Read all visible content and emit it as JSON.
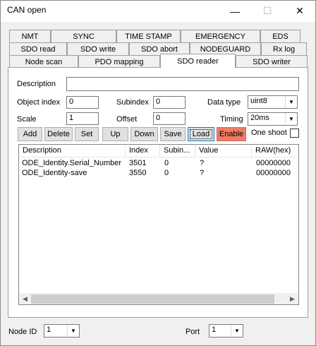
{
  "window": {
    "title": "CAN open",
    "minimize": "—",
    "maximize": "☐",
    "close": "✕"
  },
  "tabs": {
    "row1": [
      "NMT",
      "SYNC",
      "TIME STAMP",
      "EMERGENCY",
      "EDS"
    ],
    "row2": [
      "SDO read",
      "SDO write",
      "SDO abort",
      "NODEGUARD",
      "Rx log"
    ],
    "row3": [
      "Node scan",
      "PDO mapping",
      "SDO reader",
      "SDO writer"
    ],
    "active": "SDO reader"
  },
  "form": {
    "description_label": "Description",
    "description_value": "",
    "object_index_label": "Object index",
    "object_index_value": "0",
    "subindex_label": "Subindex",
    "subindex_value": "0",
    "data_type_label": "Data type",
    "data_type_value": "uint8",
    "scale_label": "Scale",
    "scale_value": "1",
    "offset_label": "Offset",
    "offset_value": "0",
    "timing_label": "Timing",
    "timing_value": "20ms"
  },
  "toolbar": {
    "add": "Add",
    "delete": "Delete",
    "set": "Set",
    "up": "Up",
    "down": "Down",
    "save": "Save",
    "load": "Load",
    "enable": "Enable",
    "one_shot": "One shoot"
  },
  "table": {
    "columns": [
      "Description",
      "Index",
      "Subin...",
      "Value",
      "RAW(hex)"
    ],
    "rows": [
      [
        "ODE_Identity.Serial_Number",
        "3501",
        "0",
        "?",
        "00000000"
      ],
      [
        "ODE_Identity-save",
        "3550",
        "0",
        "?",
        "00000000"
      ]
    ]
  },
  "footer": {
    "node_id_label": "Node ID",
    "node_id_value": "1",
    "port_label": "Port",
    "port_value": "1"
  },
  "colors": {
    "enable_button": "#f07b64",
    "focus_border": "#0078d7"
  }
}
